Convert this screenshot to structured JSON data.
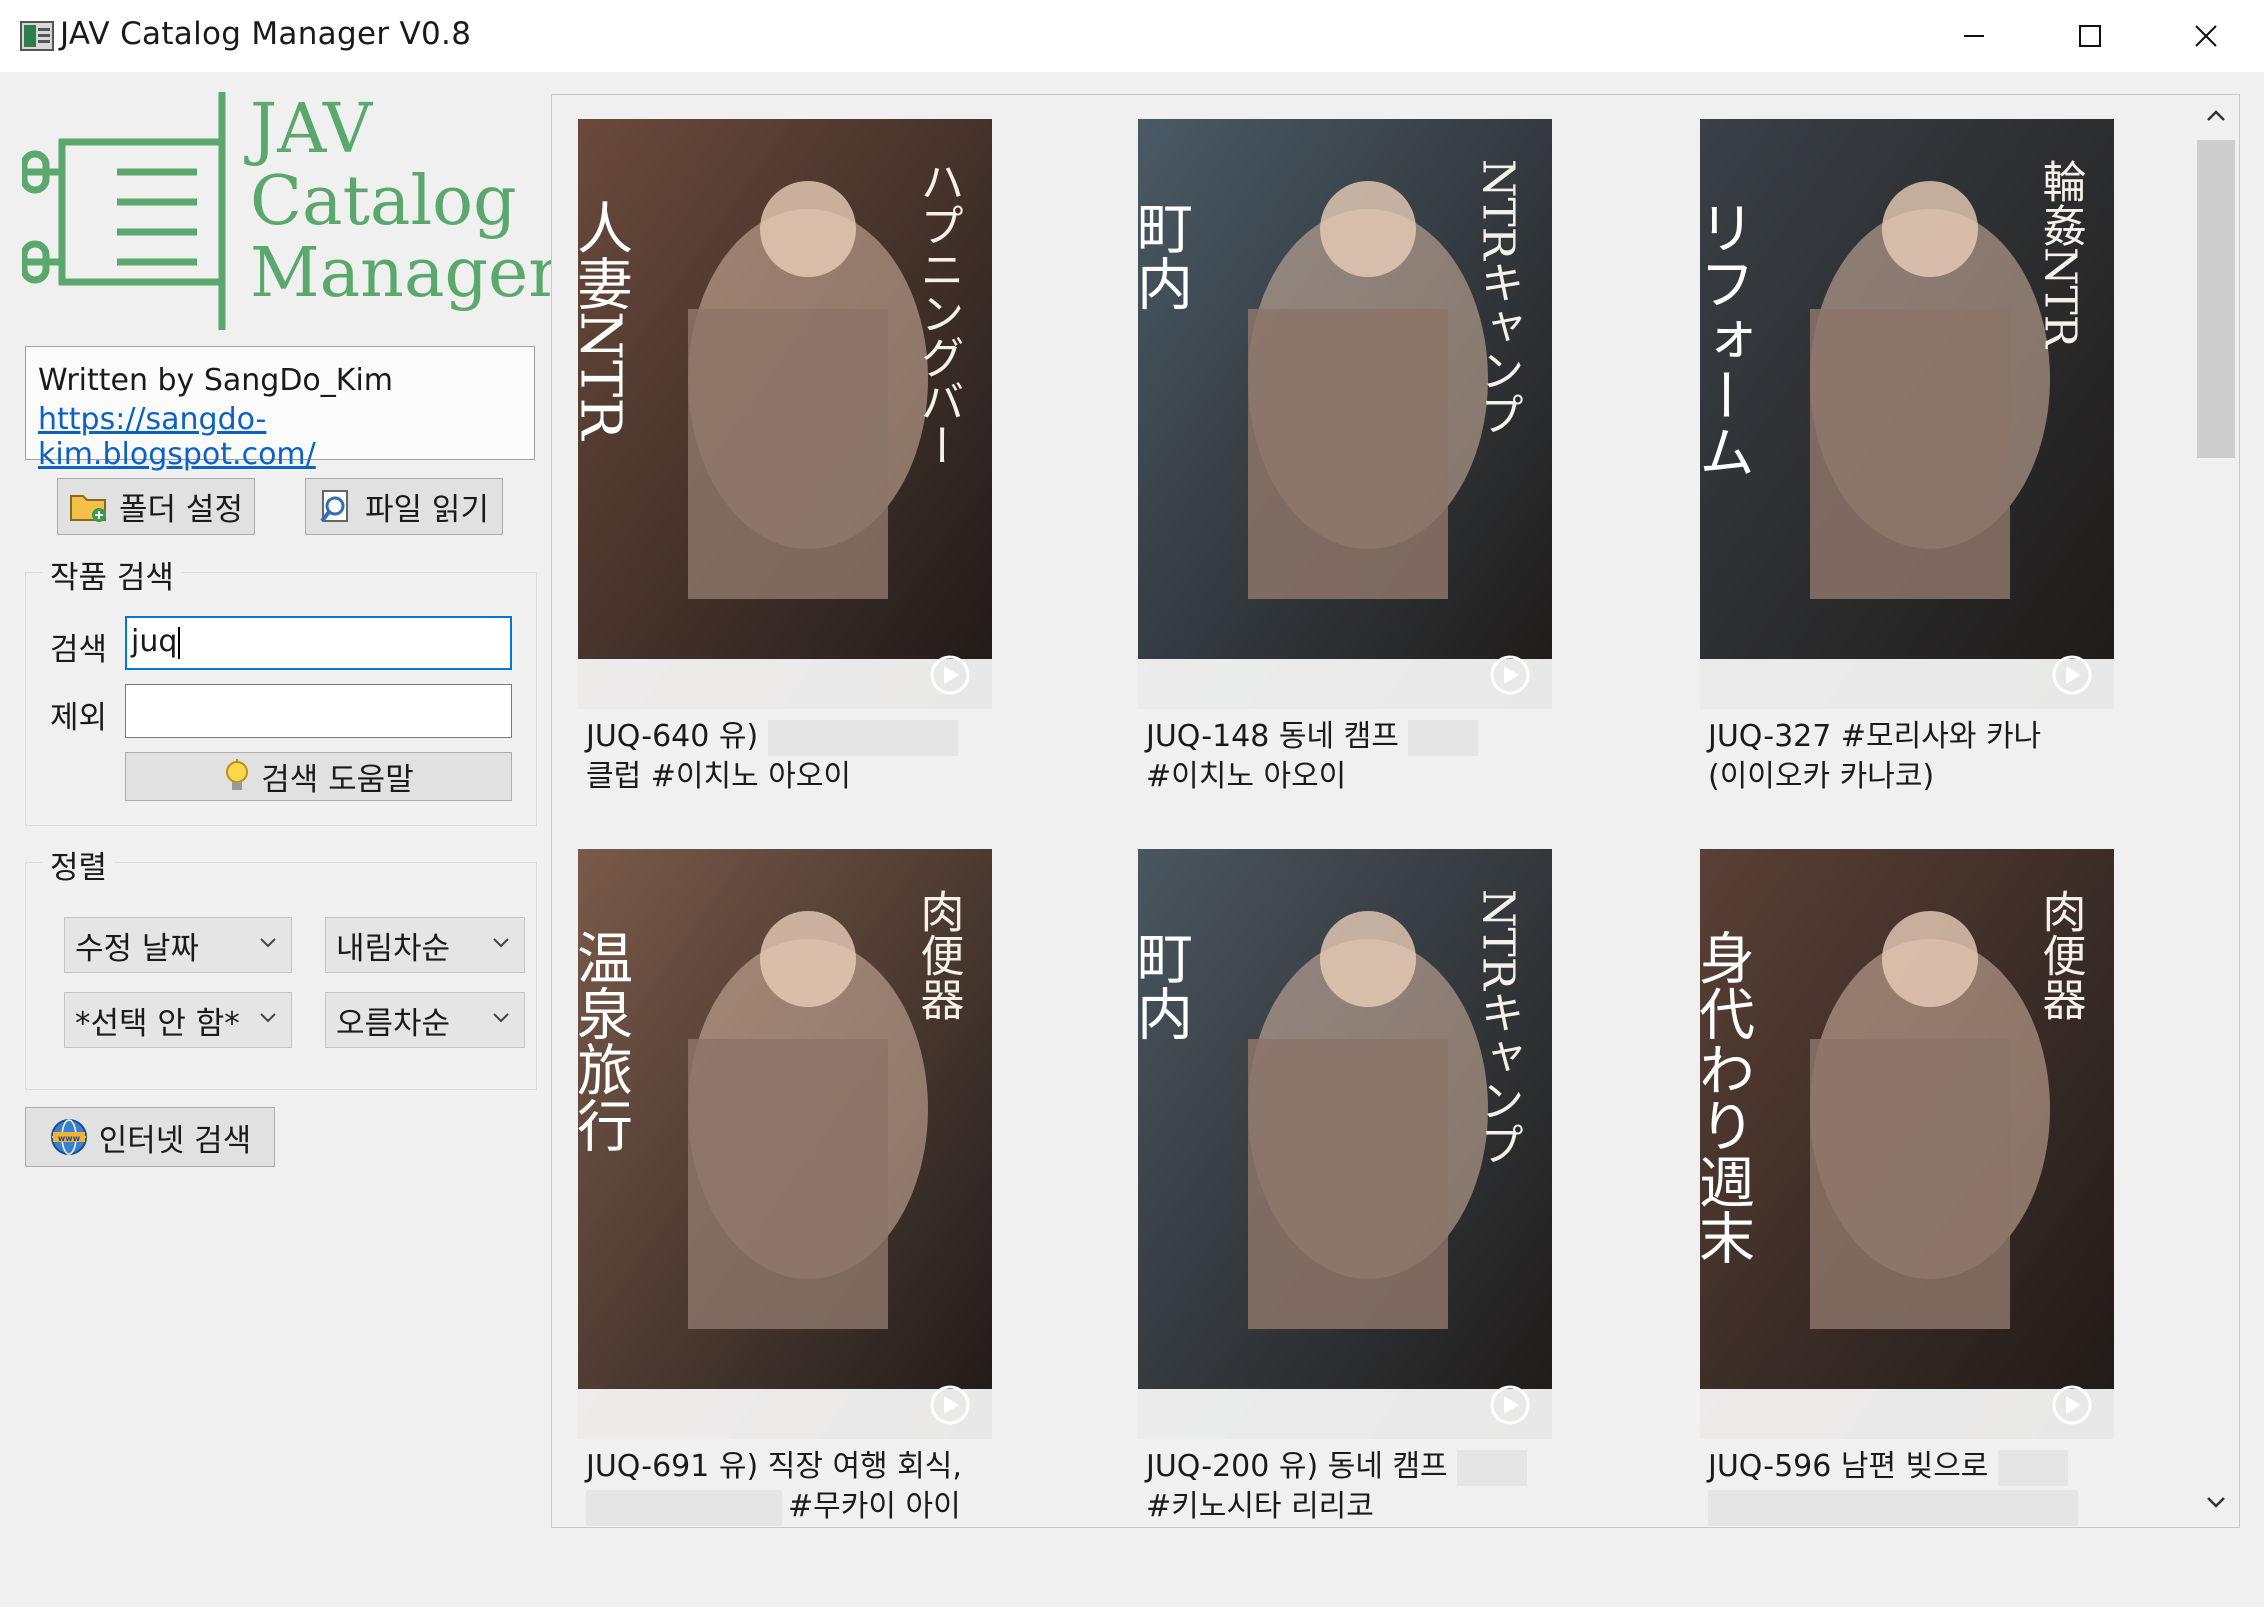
{
  "window": {
    "title": "JAV Catalog Manager V0.8"
  },
  "logo": {
    "line1": "JAV",
    "line2": "Catalog",
    "line3": "Manager",
    "color": "#5aa86c"
  },
  "author": {
    "name": "Written by SangDo_Kim",
    "link": "https://sangdo-kim.blogspot.com/"
  },
  "buttons": {
    "folder_settings": "폴더 설정",
    "read_files": "파일 읽기",
    "search_help": "검색 도움말",
    "internet_search": "인터넷 검색"
  },
  "search": {
    "group_title": "작품 검색",
    "search_label": "검색",
    "search_value": "juq",
    "exclude_label": "제외",
    "exclude_value": ""
  },
  "sort": {
    "group_title": "정렬",
    "primary_field": "수정 날짜",
    "primary_order": "내림차순",
    "secondary_field": "*선택 안 함*",
    "secondary_order": "오름차순"
  },
  "catalog": {
    "items": [
      {
        "caption": "JUQ-640 유)",
        "caption2": "클럽 #이치노 아오이",
        "cover_color": "#6b4a3c",
        "cover_text": "人妻NTR",
        "cover_text2": "ハプニングバー"
      },
      {
        "caption": "JUQ-148 동네 캠프",
        "caption2": "#이치노 아오이",
        "cover_color": "#4a5a66",
        "cover_text": "町内",
        "cover_text2": "NTRキャンプ"
      },
      {
        "caption": "JUQ-327 #모리사와 카나",
        "caption2": "(이이오카 카나코)",
        "cover_color": "#3a4046",
        "cover_text": "リフォーム",
        "cover_text2": "輪姦NTR"
      },
      {
        "caption": "JUQ-691 유) 직장 여행 회식,",
        "caption2": "#무카이 아이",
        "cover_color": "#7a5a4a",
        "cover_text": "温泉旅行",
        "cover_text2": "肉便器"
      },
      {
        "caption": "JUQ-200 유) 동네 캠프",
        "caption2": "#키노시타 리리코",
        "cover_color": "#4a5660",
        "cover_text": "町内",
        "cover_text2": "NTRキャンプ"
      },
      {
        "caption": "JUQ-596 남편 빚으로",
        "caption2": "",
        "cover_color": "#5a4036",
        "cover_text": "身代わり週末",
        "cover_text2": "肉便器"
      }
    ]
  },
  "colors": {
    "accent_focus": "#0078d7",
    "link": "#0b62c4"
  }
}
